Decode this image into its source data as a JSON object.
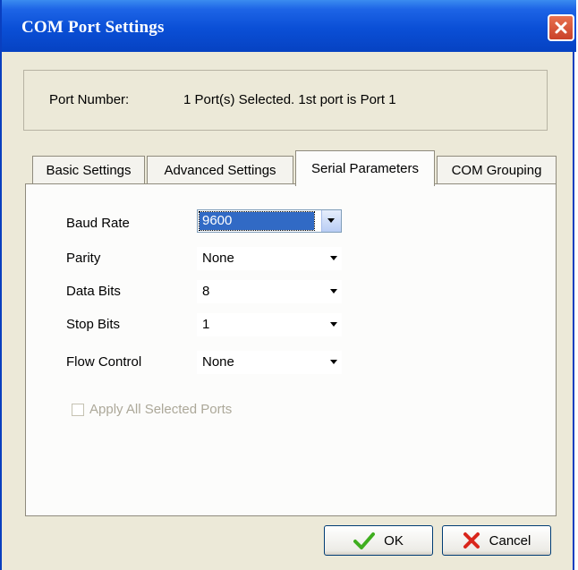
{
  "window": {
    "title": "COM Port Settings"
  },
  "port": {
    "label": "Port Number:",
    "value": "1 Port(s) Selected. 1st port is Port 1"
  },
  "tabs": [
    {
      "label": "Basic Settings",
      "active": false
    },
    {
      "label": "Advanced Settings",
      "active": false
    },
    {
      "label": "Serial Parameters",
      "active": true
    },
    {
      "label": "COM Grouping",
      "active": false
    }
  ],
  "fields": [
    {
      "label": "Baud Rate",
      "value": "9600"
    },
    {
      "label": "Parity",
      "value": "None"
    },
    {
      "label": "Data Bits",
      "value": "8"
    },
    {
      "label": "Stop Bits",
      "value": "1"
    },
    {
      "label": "Flow Control",
      "value": "None"
    }
  ],
  "apply_all": {
    "label": "Apply All Selected Ports",
    "checked": false,
    "enabled": false
  },
  "buttons": {
    "ok": "OK",
    "cancel": "Cancel"
  },
  "colors": {
    "title_bar": "#0a4fd6",
    "close": "#d9522f",
    "selection": "#316ac5",
    "ok_check": "#3fae1f",
    "cancel_x": "#d9261c"
  }
}
